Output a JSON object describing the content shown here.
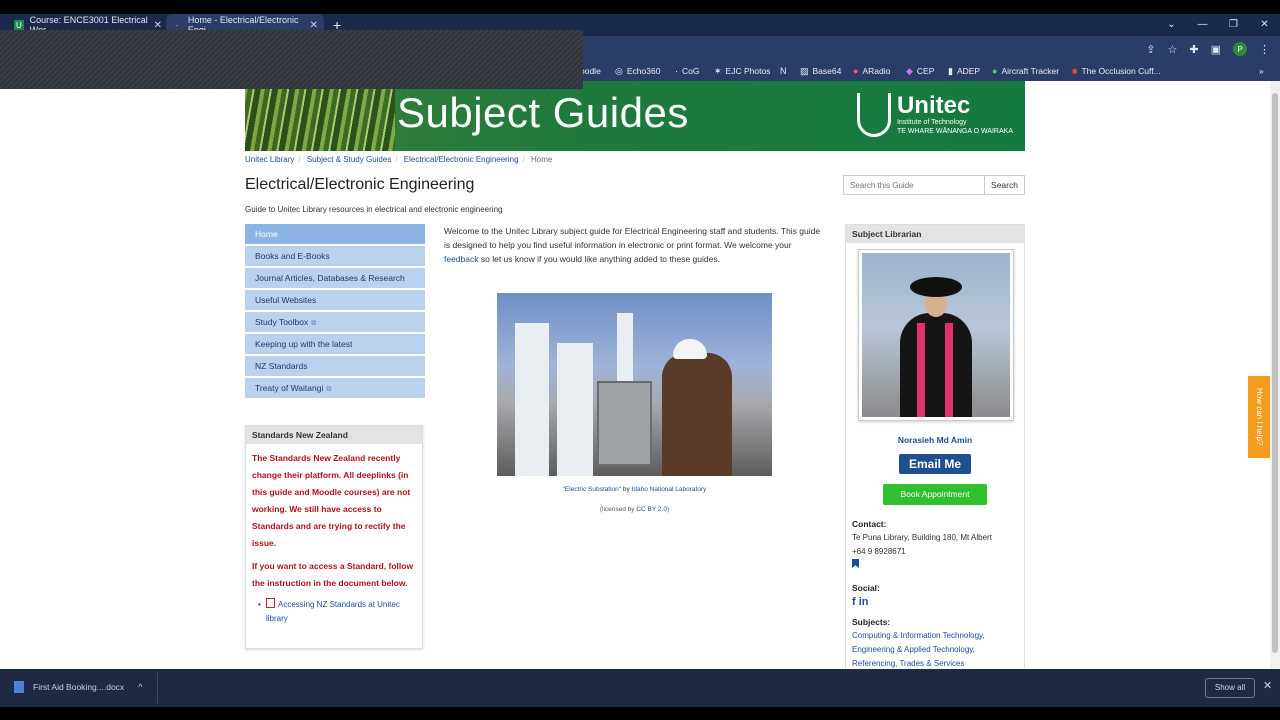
{
  "browser": {
    "tabs": [
      {
        "title": "Course: ENCE3001 Electrical Wor",
        "active": false
      },
      {
        "title": "Home - Electrical/Electronic Engi",
        "active": true
      }
    ],
    "bookmarks": [
      "oodle",
      "Echo360",
      "CoG",
      "EJC Photos",
      "Base64",
      "ARadio",
      "CEP",
      "ADEP",
      "Aircraft Tracker",
      "The Occlusion Cuff..."
    ],
    "profile_initial": "P"
  },
  "banner": {
    "title": "Subject Guides",
    "logo_name": "Unitec",
    "logo_sub1": "Institute of Technology",
    "logo_sub2": "TE WHARE WĀNANGA O WAIRAKA"
  },
  "breadcrumb": [
    "Unitec Library",
    "Subject & Study Guides",
    "Electrical/Electronic Engineering",
    "Home"
  ],
  "guide": {
    "title": "Electrical/Electronic Engineering",
    "description": "Guide to Unitec Library resources in electrical and electronic engineering"
  },
  "search": {
    "placeholder": "Search this Guide",
    "button": "Search"
  },
  "nav": [
    {
      "label": "Home",
      "active": true
    },
    {
      "label": "Books and E-Books"
    },
    {
      "label": "Journal Articles, Databases & Research"
    },
    {
      "label": "Useful Websites"
    },
    {
      "label": "Study Toolbox",
      "external": true
    },
    {
      "label": "Keeping up with the latest"
    },
    {
      "label": "NZ Standards"
    },
    {
      "label": "Treaty of Waitangi",
      "external": true
    }
  ],
  "standards_box": {
    "heading": "Standards New Zealand",
    "para1": "The Standards New Zealand recently change their platform. All deeplinks (in this guide and Moodle courses) are not working. We still have access to Standards and are trying to rectify the issue.",
    "para2": "If you want to access a Standard, follow the instruction in the document below.",
    "link": "Accessing NZ Standards at Unitec library"
  },
  "welcome": {
    "text_before": "Welcome to the Unitec Library subject guide for Electrical Engineering staff and students.  This guide is designed to help you find useful information in electronic or print format.  We welcome your ",
    "link": "feedback",
    "text_after": " so let us know if you would like anything added to these guides."
  },
  "photo_caption": {
    "title": "\"Electric Substation\"",
    "by": " by ",
    "author": "Idaho National Laboratory",
    "license_pre": "(licensed by ",
    "license": "CC BY 2.0",
    "license_post": ")"
  },
  "librarian": {
    "heading": "Subject Librarian",
    "name": "Norasieh Md Amin",
    "email_button": "Email Me",
    "appointment_button": "Book Appointment",
    "contact_label": "Contact:",
    "address": "Te Puna Library, Building 180, Mt Albert",
    "phone": "+64 9 8928671",
    "social_label": "Social:",
    "social_icons": "f in",
    "subjects_label": "Subjects:",
    "subjects": "Computing & Information Technology, Engineering & Applied Technology, Referencing, Trades & Services"
  },
  "help_tab": "How can I help?",
  "downloads": {
    "file": "First Aid Booking....docx",
    "show_all": "Show all"
  }
}
